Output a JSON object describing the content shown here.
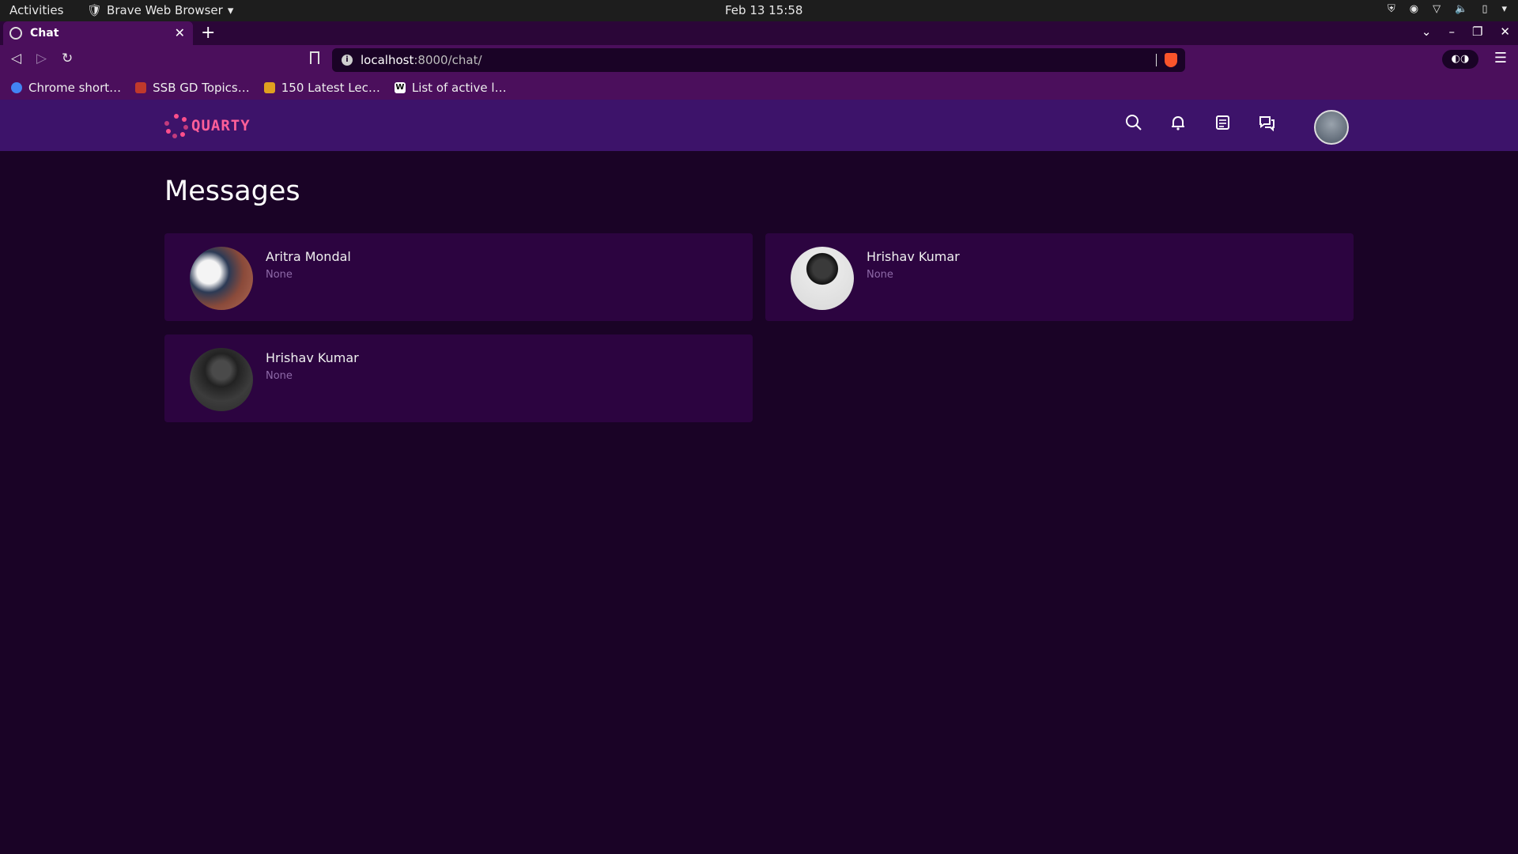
{
  "system_bar": {
    "activities": "Activities",
    "app_name": "Brave Web Browser",
    "datetime": "Feb 13  15:58"
  },
  "browser": {
    "tab_title": "Chat",
    "url_host": "localhost",
    "url_path": ":8000/chat/",
    "bookmarks": [
      {
        "label": "Chrome short…",
        "color": "#4285f4"
      },
      {
        "label": "SSB GD Topics…",
        "color": "#c0392b"
      },
      {
        "label": "150 Latest Lec…",
        "color": "#e0a020"
      },
      {
        "label": "List of active l…",
        "color": "#ffffff"
      }
    ]
  },
  "app": {
    "logo_text": "QUARTY",
    "accent": "#ff5f99",
    "header_bg": "#3d136a",
    "page_bg": "#1a0326"
  },
  "page": {
    "title": "Messages"
  },
  "conversations": [
    {
      "name": "Aritra Mondal",
      "status": "None"
    },
    {
      "name": "Hrishav Kumar",
      "status": "None"
    },
    {
      "name": "Hrishav Kumar",
      "status": "None"
    }
  ]
}
